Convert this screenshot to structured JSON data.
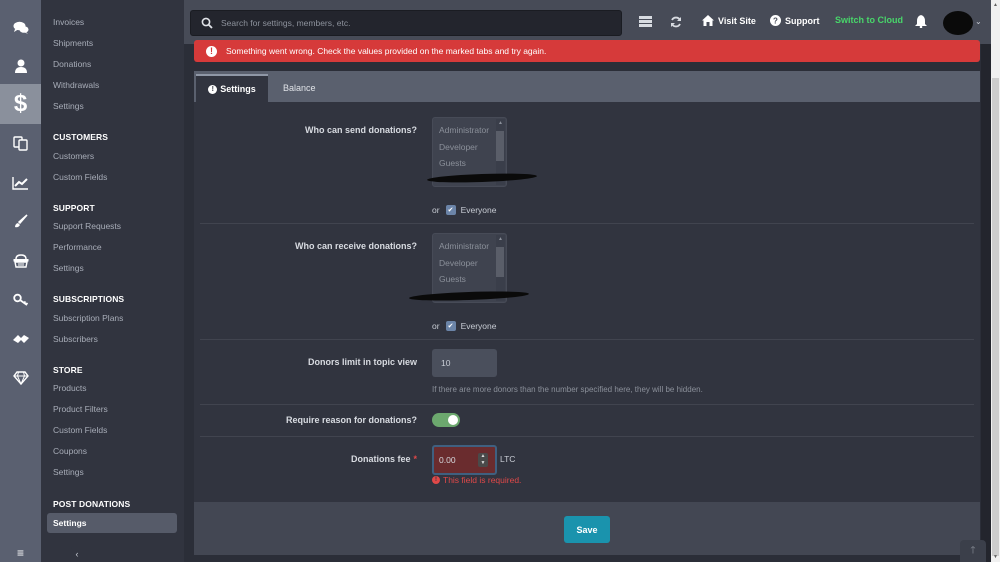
{
  "rail": {
    "items": [
      {
        "icon": "chat-bubbles-icon"
      },
      {
        "icon": "user-icon"
      },
      {
        "icon": "dollar-icon",
        "active": true
      },
      {
        "icon": "copy-pages-icon"
      },
      {
        "icon": "chart-line-icon"
      },
      {
        "icon": "paintbrush-icon"
      },
      {
        "icon": "basket-icon"
      },
      {
        "icon": "key-icon"
      },
      {
        "icon": "handshake-icon"
      },
      {
        "icon": "diamond-icon"
      }
    ],
    "footer_icon": "menu-icon",
    "collapse_icon": "chevron-left-icon",
    "collapse_glyph": "‹",
    "menu_glyph": "≡"
  },
  "nav": {
    "top_links": [
      "Invoices",
      "Shipments",
      "Donations",
      "Withdrawals",
      "Settings"
    ],
    "groups": [
      {
        "title": "CUSTOMERS",
        "links": [
          "Customers",
          "Custom Fields"
        ]
      },
      {
        "title": "SUPPORT",
        "links": [
          "Support Requests",
          "Performance",
          "Settings"
        ]
      },
      {
        "title": "SUBSCRIPTIONS",
        "links": [
          "Subscription Plans",
          "Subscribers"
        ]
      },
      {
        "title": "STORE",
        "links": [
          "Products",
          "Product Filters",
          "Custom Fields",
          "Coupons",
          "Settings"
        ]
      },
      {
        "title": "POST DONATIONS",
        "links": [
          "Settings"
        ],
        "active_index": 0
      }
    ]
  },
  "topbar": {
    "search_placeholder": "Search for settings, members, etc.",
    "visit_site": "Visit Site",
    "support": "Support",
    "switch_cloud": "Switch to Cloud",
    "cloud_color": "#48d66a",
    "avatar_caret": "⌄"
  },
  "alert": {
    "icon_glyph": "!",
    "message": "Something went wrong. Check the values provided on the marked tabs and try again.",
    "color": "#d63a3a"
  },
  "tabs": [
    {
      "label": "Settings",
      "active": true,
      "has_error_icon": true,
      "icon_glyph": "!"
    },
    {
      "label": "Balance",
      "active": false
    }
  ],
  "form": {
    "send": {
      "label": "Who can send donations?",
      "options": [
        "Administrator",
        "Developer",
        "Guests"
      ],
      "or_text": "or",
      "everyone_label": "Everyone",
      "everyone_checked": true
    },
    "receive": {
      "label": "Who can receive donations?",
      "options": [
        "Administrator",
        "Developer",
        "Guests"
      ],
      "or_text": "or",
      "everyone_label": "Everyone",
      "everyone_checked": true
    },
    "donors_limit": {
      "label": "Donors limit in topic view",
      "value": "10",
      "hint": "If there are more donors than the number specified here, they will be hidden."
    },
    "require_reason": {
      "label": "Require reason for donations?",
      "enabled": true
    },
    "fee": {
      "label": "Donations fee",
      "required_mark": "*",
      "value": "0.00",
      "unit": "LTC",
      "error": "This field is required.",
      "error_icon_glyph": "!"
    },
    "check_glyph": "✔"
  },
  "footer": {
    "save_label": "Save"
  },
  "scroll_top_glyph": "🡑"
}
